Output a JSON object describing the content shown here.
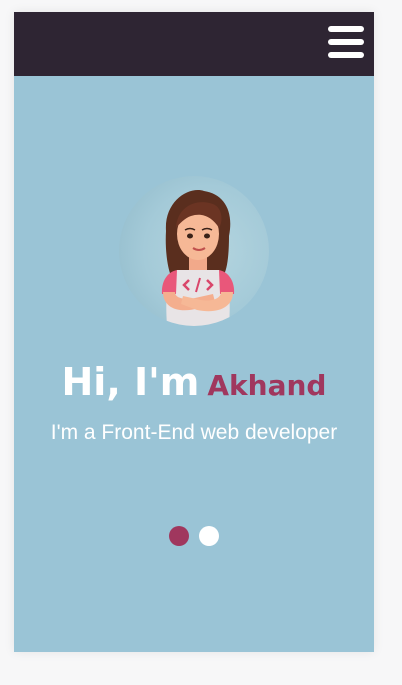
{
  "header": {
    "menu_icon": "hamburger-menu-icon",
    "background_color": "#2e2533"
  },
  "hero": {
    "greeting": "Hi, I'm",
    "name": "Akhand",
    "tagline": "I'm a Front-End web developer",
    "avatar_icon": "developer-avatar-icon",
    "accent_color": "#a0375e",
    "background_color": "#9ac4d6"
  },
  "carousel": {
    "slides_count": 2,
    "active_index": 0
  }
}
